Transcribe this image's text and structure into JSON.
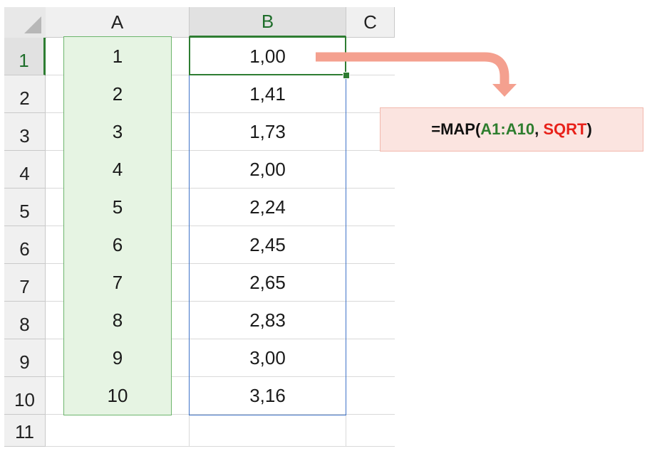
{
  "columns": [
    {
      "id": "A",
      "label": "A"
    },
    {
      "id": "B",
      "label": "B"
    },
    {
      "id": "C",
      "label": "C"
    }
  ],
  "rows": [
    "1",
    "2",
    "3",
    "4",
    "5",
    "6",
    "7",
    "8",
    "9",
    "10",
    "11"
  ],
  "column_a_values": [
    "1",
    "2",
    "3",
    "4",
    "5",
    "6",
    "7",
    "8",
    "9",
    "10"
  ],
  "column_b_values": [
    "1,00",
    "1,41",
    "1,73",
    "2,00",
    "2,24",
    "2,45",
    "2,65",
    "2,83",
    "3,00",
    "3,16"
  ],
  "formula": {
    "prefix": "=MAP(",
    "range": "A1:A10",
    "separator": ", ",
    "function_arg": "SQRT",
    "suffix": ")"
  },
  "colors": {
    "range_green": "#2e7d2e",
    "lambda_red": "#e8211a",
    "arrow": "#f4a08f",
    "formula_bg": "#fbe4e0"
  }
}
